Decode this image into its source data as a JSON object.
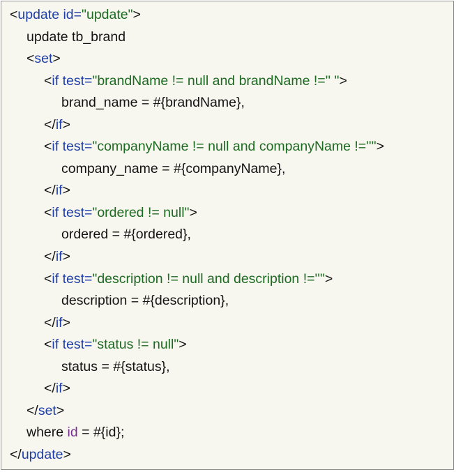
{
  "colors": {
    "background": "#f7f7ef",
    "border": "#8f8f8f",
    "tag": "#1f3fa8",
    "string": "#1d6a22",
    "text": "#141414",
    "identifier": "#7a2f8e"
  },
  "lines": [
    {
      "indent": 0,
      "segments": [
        {
          "text": "<",
          "color": "text"
        },
        {
          "text": "update",
          "color": "tag"
        },
        {
          "text": " ",
          "color": "text"
        },
        {
          "text": "id=",
          "color": "tag"
        },
        {
          "text": "\"update\"",
          "color": "string"
        },
        {
          "text": ">",
          "color": "text"
        }
      ]
    },
    {
      "indent": 1,
      "segments": [
        {
          "text": "update tb_brand",
          "color": "text"
        }
      ]
    },
    {
      "indent": 1,
      "segments": [
        {
          "text": "<",
          "color": "text"
        },
        {
          "text": "set",
          "color": "tag"
        },
        {
          "text": ">",
          "color": "text"
        }
      ]
    },
    {
      "indent": 2,
      "segments": [
        {
          "text": "<",
          "color": "text"
        },
        {
          "text": "if",
          "color": "tag"
        },
        {
          "text": " ",
          "color": "text"
        },
        {
          "text": "test=",
          "color": "tag"
        },
        {
          "text": "\"brandName != null and brandName !='' \"",
          "color": "string"
        },
        {
          "text": ">",
          "color": "text"
        }
      ]
    },
    {
      "indent": 3,
      "segments": [
        {
          "text": "brand_name = #{brandName},",
          "color": "text"
        }
      ]
    },
    {
      "indent": 2,
      "segments": [
        {
          "text": "</",
          "color": "text"
        },
        {
          "text": "if",
          "color": "tag"
        },
        {
          "text": ">",
          "color": "text"
        }
      ]
    },
    {
      "indent": 2,
      "segments": [
        {
          "text": "<",
          "color": "text"
        },
        {
          "text": "if",
          "color": "tag"
        },
        {
          "text": " ",
          "color": "text"
        },
        {
          "text": "test=",
          "color": "tag"
        },
        {
          "text": "\"companyName != null and companyName !=''\"",
          "color": "string"
        },
        {
          "text": ">",
          "color": "text"
        }
      ]
    },
    {
      "indent": 3,
      "segments": [
        {
          "text": "company_name = #{companyName},",
          "color": "text"
        }
      ]
    },
    {
      "indent": 2,
      "segments": [
        {
          "text": "</",
          "color": "text"
        },
        {
          "text": "if",
          "color": "tag"
        },
        {
          "text": ">",
          "color": "text"
        }
      ]
    },
    {
      "indent": 2,
      "segments": [
        {
          "text": "<",
          "color": "text"
        },
        {
          "text": "if",
          "color": "tag"
        },
        {
          "text": " ",
          "color": "text"
        },
        {
          "text": "test=",
          "color": "tag"
        },
        {
          "text": "\"ordered != null\"",
          "color": "string"
        },
        {
          "text": ">",
          "color": "text"
        }
      ]
    },
    {
      "indent": 3,
      "segments": [
        {
          "text": "ordered = #{ordered},",
          "color": "text"
        }
      ]
    },
    {
      "indent": 2,
      "segments": [
        {
          "text": "</",
          "color": "text"
        },
        {
          "text": "if",
          "color": "tag"
        },
        {
          "text": ">",
          "color": "text"
        }
      ]
    },
    {
      "indent": 2,
      "segments": [
        {
          "text": "<",
          "color": "text"
        },
        {
          "text": "if",
          "color": "tag"
        },
        {
          "text": " ",
          "color": "text"
        },
        {
          "text": "test=",
          "color": "tag"
        },
        {
          "text": "\"description != null and description !=''\"",
          "color": "string"
        },
        {
          "text": ">",
          "color": "text"
        }
      ]
    },
    {
      "indent": 3,
      "segments": [
        {
          "text": "description = #{description},",
          "color": "text"
        }
      ]
    },
    {
      "indent": 2,
      "segments": [
        {
          "text": "</",
          "color": "text"
        },
        {
          "text": "if",
          "color": "tag"
        },
        {
          "text": ">",
          "color": "text"
        }
      ]
    },
    {
      "indent": 2,
      "segments": [
        {
          "text": "<",
          "color": "text"
        },
        {
          "text": "if",
          "color": "tag"
        },
        {
          "text": " ",
          "color": "text"
        },
        {
          "text": "test=",
          "color": "tag"
        },
        {
          "text": "\"status != null\"",
          "color": "string"
        },
        {
          "text": ">",
          "color": "text"
        }
      ]
    },
    {
      "indent": 3,
      "segments": [
        {
          "text": "status = #{status},",
          "color": "text"
        }
      ]
    },
    {
      "indent": 2,
      "segments": [
        {
          "text": "</",
          "color": "text"
        },
        {
          "text": "if",
          "color": "tag"
        },
        {
          "text": ">",
          "color": "text"
        }
      ]
    },
    {
      "indent": 1,
      "segments": [
        {
          "text": "</",
          "color": "text"
        },
        {
          "text": "set",
          "color": "tag"
        },
        {
          "text": ">",
          "color": "text"
        }
      ]
    },
    {
      "indent": 1,
      "segments": [
        {
          "text": "where ",
          "color": "text"
        },
        {
          "text": "id",
          "color": "identifier"
        },
        {
          "text": " = #{id};",
          "color": "text"
        }
      ]
    },
    {
      "indent": 0,
      "segments": [
        {
          "text": "</",
          "color": "text"
        },
        {
          "text": "update",
          "color": "tag"
        },
        {
          "text": ">",
          "color": "text"
        }
      ]
    }
  ]
}
